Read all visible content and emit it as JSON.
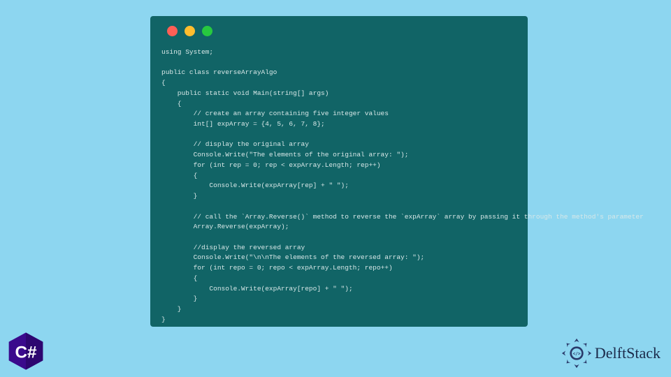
{
  "code": "using System;\n\npublic class reverseArrayAlgo\n{\n    public static void Main(string[] args)\n    {\n        // create an array containing five integer values\n        int[] expArray = {4, 5, 6, 7, 8};\n\n        // display the original array\n        Console.Write(\"The elements of the original array: \");\n        for (int rep = 0; rep < expArray.Length; rep++)\n        {\n            Console.Write(expArray[rep] + \" \");\n        }\n\n        // call the `Array.Reverse()` method to reverse the `expArray` array by passing it through the method's parameter\n        Array.Reverse(expArray);\n\n        //display the reversed array\n        Console.Write(\"\\n\\nThe elements of the reversed array: \");\n        for (int repo = 0; repo < expArray.Length; repo++)\n        {\n            Console.Write(expArray[repo] + \" \");\n        }\n    }\n}",
  "brand": {
    "name": "DelftStack",
    "logo_color": "#2a3a6a"
  },
  "csharp": {
    "label": "C#",
    "bg": "#3a0a8c",
    "fg": "#ffffff"
  },
  "window": {
    "bg": "#116466",
    "dots": [
      "#ff5f56",
      "#ffbd2e",
      "#27c93f"
    ]
  }
}
